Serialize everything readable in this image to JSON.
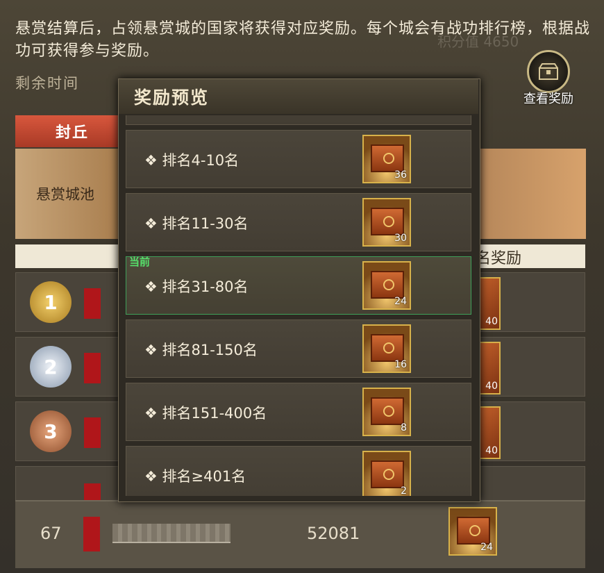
{
  "intro_text": "悬赏结算后，占领悬赏城的国家将获得对应奖励。每个城会有战功排行榜，根据战功可获得参与奖励。",
  "remaining_time_label": "剩余时间",
  "ghost_score": "积分值 4650",
  "view_rewards_label": "查看奖励",
  "city_tab_label": "封丘",
  "city_banner_label": "悬赏城池",
  "column_header_right": "名奖励",
  "top_rows": [
    {
      "rank": "1",
      "reward_count": "40"
    },
    {
      "rank": "2",
      "reward_count": "40"
    },
    {
      "rank": "3",
      "reward_count": "40"
    }
  ],
  "my_row": {
    "rank": "67",
    "score": "52081",
    "reward_count": "24"
  },
  "reward_panel": {
    "title": "奖励预览",
    "current_tag": "当前",
    "items": [
      {
        "label": "❖ 排名4-10名",
        "count": "36"
      },
      {
        "label": "❖ 排名11-30名",
        "count": "30"
      },
      {
        "label": "❖ 排名31-80名",
        "count": "24",
        "current": true
      },
      {
        "label": "❖ 排名81-150名",
        "count": "16"
      },
      {
        "label": "❖ 排名151-400名",
        "count": "8"
      },
      {
        "label": "❖ 排名≥401名",
        "count": "2"
      }
    ]
  }
}
